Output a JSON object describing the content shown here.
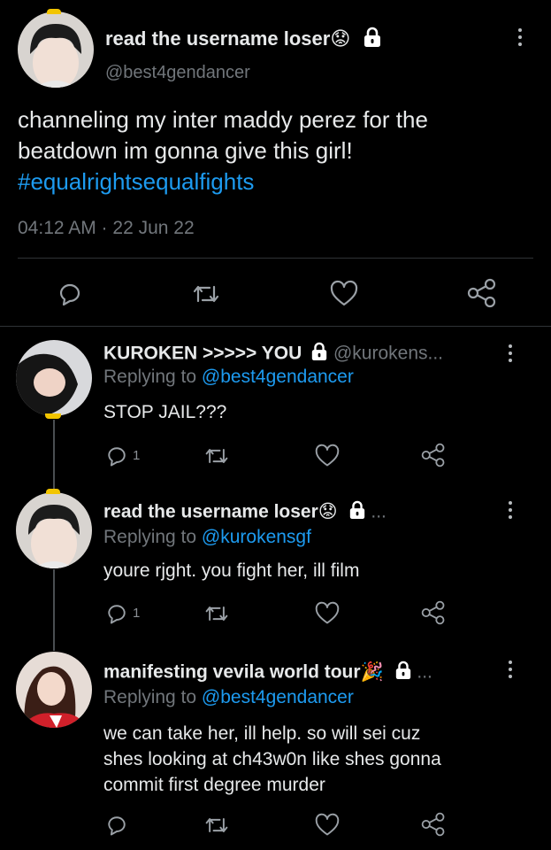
{
  "main_tweet": {
    "display_name": "read the username loser😟",
    "handle": "@best4gendancer",
    "text_line1": "channeling my inter maddy perez for the",
    "text_line2": "beatdown im gonna give this girl!",
    "hashtag": "#equalrightsequalfights",
    "timestamp": "04:12 AM · 22 Jun 22",
    "actions": [
      "reply-icon",
      "retweet-icon",
      "like-icon",
      "share-icon"
    ]
  },
  "replies": [
    {
      "display_name": "KUROKEN >>>>> YOU",
      "handle": "@kurokens...",
      "replying_label": "Replying to",
      "replying_to": "@best4gendancer",
      "text": "STOP JAIL???",
      "reply_count": "1"
    },
    {
      "display_name": "read the username loser😟",
      "handle": "...",
      "replying_label": "Replying to",
      "replying_to": "@kurokensgf",
      "text": "youre rjght. you fight her, ill film",
      "reply_count": "1"
    },
    {
      "display_name": "manifesting vevila world tour🎉",
      "handle": "...",
      "replying_label": "Replying to",
      "replying_to": "@best4gendancer",
      "text_line1": "we can take her, ill help. so will sei cuz",
      "text_line2": "shes looking at ch43w0n like shes gonna",
      "text_line3": "commit first degree murder"
    }
  ],
  "colors": {
    "background": "#000000",
    "text": "#e7e9ea",
    "muted": "#71767b",
    "link": "#1d9bf0",
    "divider": "#2f3336"
  }
}
